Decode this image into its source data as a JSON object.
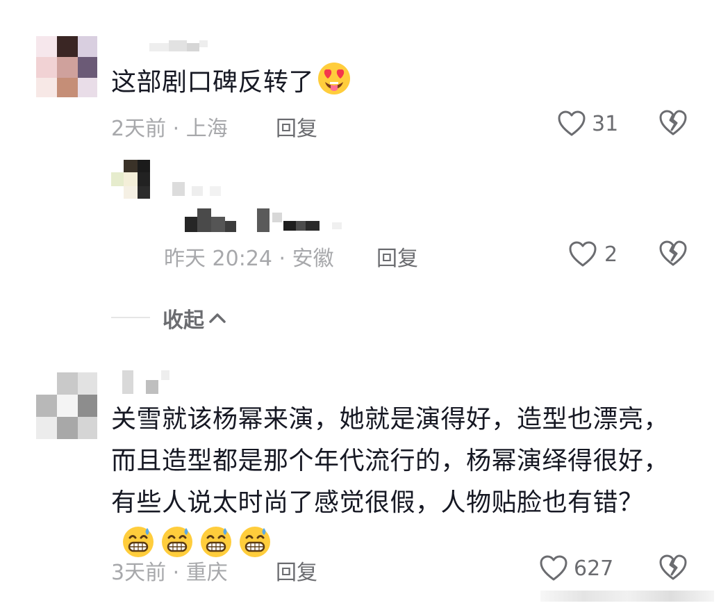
{
  "comments": [
    {
      "text": "这部剧口碑反转了",
      "emoji": "heart-eyes-tongue",
      "meta": "2天前 · 上海",
      "reply_label": "回复",
      "likes": "31"
    },
    {
      "meta": "昨天 20:24 · 安徽",
      "reply_label": "回复",
      "likes": "2"
    },
    {
      "text": "关雪就该杨幂来演，她就是演得好，造型也漂亮，而且造型都是那个年代流行的，杨幂演绎得很好，有些人说太时尚了感觉很假，人物贴脸也有错？",
      "emoji": "grinning-sweat",
      "emoji_count": 4,
      "meta": "3天前 · 重庆",
      "reply_label": "回复",
      "likes": "627"
    }
  ],
  "collapse_label": "收起",
  "icons": {
    "like": "heart-outline-icon",
    "dislike": "broken-heart-icon",
    "collapse": "chevron-up-icon"
  },
  "colors": {
    "text": "#161823",
    "meta": "#a7a8ab",
    "action": "#6b6c70"
  }
}
